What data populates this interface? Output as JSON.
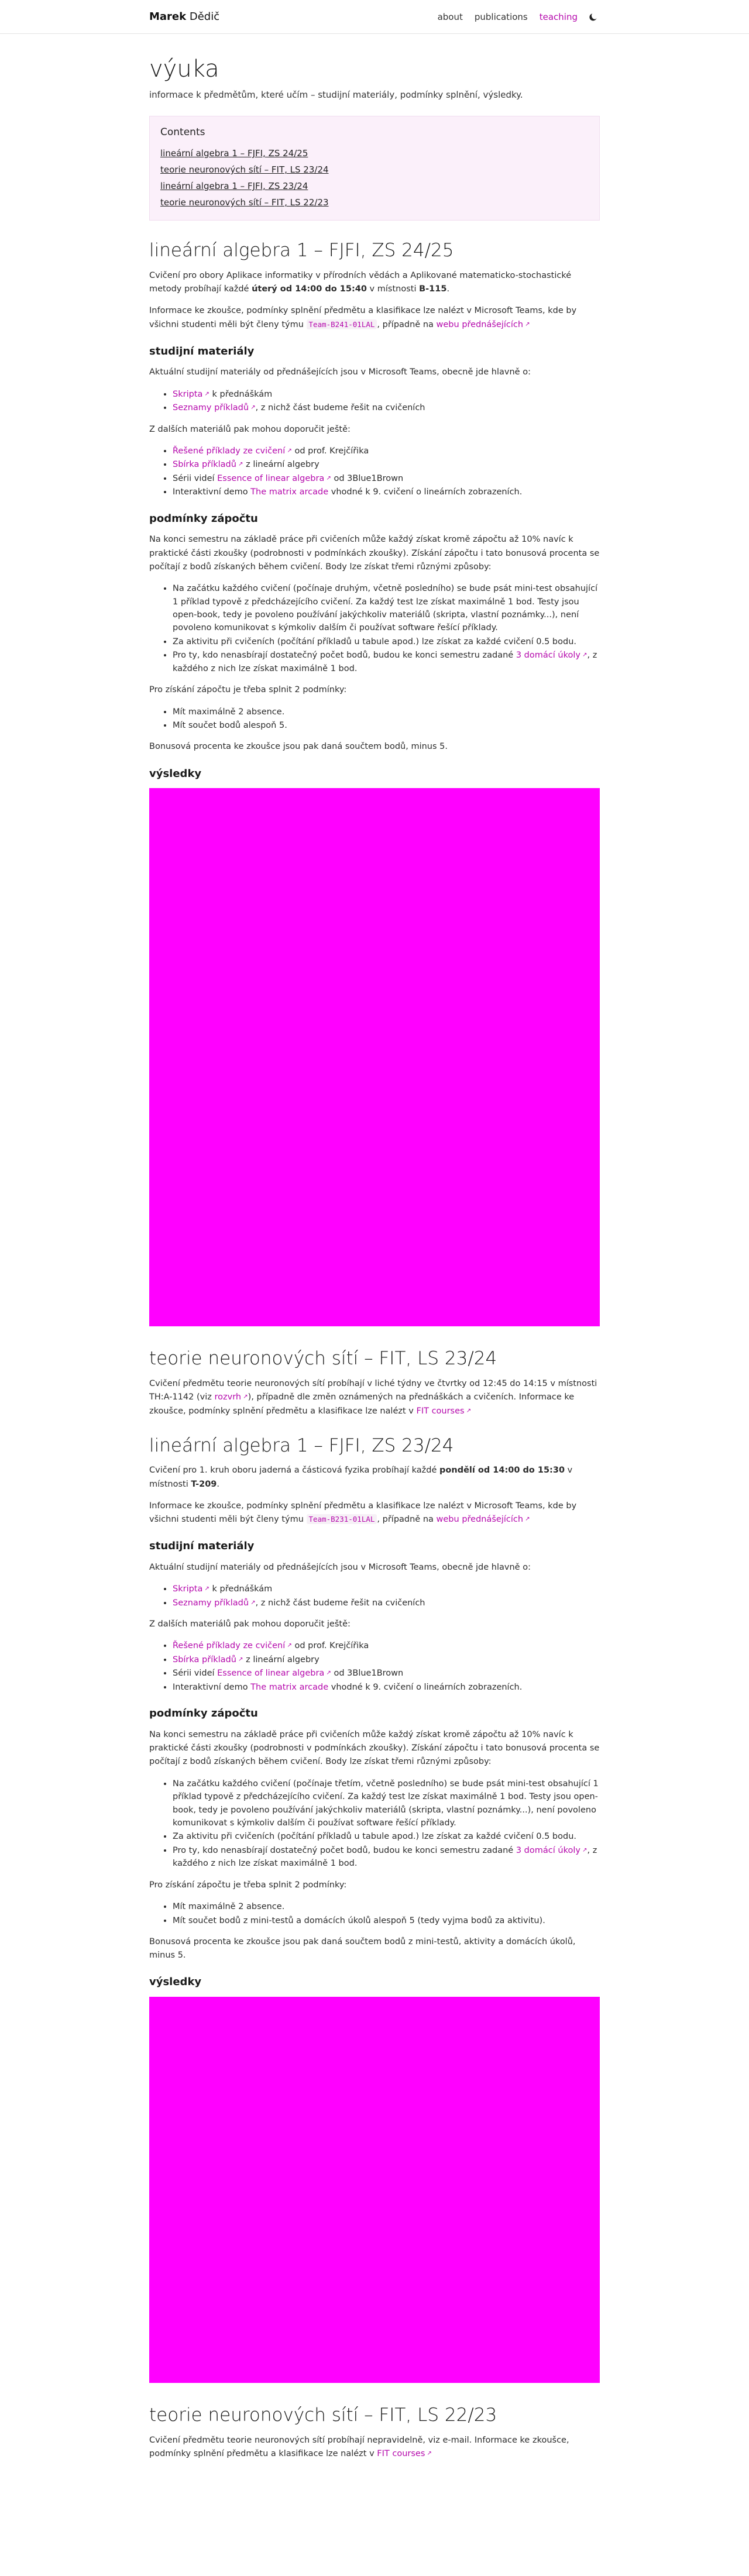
{
  "nav": {
    "brand_first": "Marek",
    "brand_last": "Dědič",
    "links": [
      "about",
      "publications",
      "teaching"
    ],
    "active": "teaching",
    "theme_icon": "moon-icon"
  },
  "page": {
    "title": "výuka",
    "description": "informace k předmětům, které učím – studijní materiály, podmínky splnění, výsledky."
  },
  "toc": {
    "title": "Contents",
    "items": [
      "lineární algebra 1 – FJFI, ZS 24/25",
      "teorie neuronových sítí – FIT, LS 23/24",
      "lineární algebra 1 – FJFI, ZS 23/24",
      "teorie neuronových sítí – FIT, LS 22/23"
    ]
  },
  "la24": {
    "title": "lineární algebra 1 – FJFI, ZS 24/25",
    "intro_a": "Cvičení pro obory Aplikace informatiky v přírodních vědách a Aplikované matematicko-stochastické metody probíhají každé ",
    "intro_time": "úterý od 14:00 do 15:40",
    "intro_b": " v místnosti ",
    "intro_room": "B-115",
    "intro_c": ".",
    "info_a": "Informace ke zkoušce, podmínky splnění předmětu a klasifikace lze nalézt v Microsoft Teams, kde by všichni studenti měli být členy týmu ",
    "team_code": "Team-B241-01LAL",
    "info_b": ", případně na ",
    "info_link": "webu přednášejících",
    "info_c": "",
    "materials_title": "studijní materiály",
    "materials_intro": "Aktuální studijní materiály od přednášejících jsou v Microsoft Teams, obecně jde hlavně o:",
    "materials_items": [
      {
        "link": "Skripta",
        "text": " k přednáškám"
      },
      {
        "link": "Seznamy příkladů",
        "text": ", z nichž část budeme řešit na cvičeních"
      }
    ],
    "extra_intro": "Z dalších materiálů pak mohou doporučit ještě:",
    "extra_items": [
      {
        "pre": "",
        "link": "Řešené příklady ze cvičení",
        "post": " od prof. Krejčířika"
      },
      {
        "pre": "",
        "link": "Sbírka příkladů",
        "post": " z lineární algebry"
      },
      {
        "pre": "Sérii videí ",
        "link": "Essence of linear algebra",
        "post": " od 3Blue1Brown"
      },
      {
        "pre": "Interaktivní demo ",
        "link": "The matrix arcade",
        "post": " vhodné k 9. cvičení o lineárních zobrazeních."
      }
    ],
    "conditions_title": "podmínky zápočtu",
    "conditions_p": "Na konci semestru na základě práce při cvičeních může každý získat kromě zápočtu až 10% navíc k praktické části zkoušky (podrobnosti v podmínkách zkoušky). Získání zápočtu i tato bonusová procenta se počítají z bodů získaných během cvičení. Body lze získat třemi různými způsoby:",
    "conditions_items": [
      {
        "pre": "Na začátku každého cvičení (počínaje druhým, včetně posledního) se bude psát mini-test obsahující 1 příklad typově z předcházejícího cvičení. Za každý test lze získat maximálně 1 bod. Testy jsou open-book, tedy je povoleno používání jakýchkoliv materiálů (skripta, vlastní poznámky...), není povoleno komunikovat s kýmkoliv dalším či používat software řešící příklady.",
        "link": "",
        "post": ""
      },
      {
        "pre": "Za aktivitu při cvičeních (počítání příkladů u tabule apod.) lze získat za každé cvičení 0.5 bodu.",
        "link": "",
        "post": ""
      },
      {
        "pre": "Pro ty, kdo nenasbírají dostatečný počet bodů, budou ke konci semestru zadané ",
        "link": "3 domácí úkoly",
        "post": ", z každého z nich lze získat maximálně 1 bod."
      }
    ],
    "req_intro": "Pro získání zápočtu je třeba splnit 2 podmínky:",
    "req_items": [
      "Mít maximálně 2 absence.",
      "Mít součet bodů alespoň 5."
    ],
    "bonus": "Bonusová procenta ke zkoušce jsou pak daná součtem bodů, minus 5.",
    "results_title": "výsledky"
  },
  "nn24": {
    "title": "teorie neuronových sítí – FIT, LS 23/24",
    "p_a": "Cvičení předmětu teorie neuronových sítí probíhají v liché týdny ve čtvrtky od 12:45 do 14:15 v místnosti TH:A-1142 (viz ",
    "p_link1": "rozvrh",
    "p_b": "), případně dle změn oznámených na přednáškách a cvičeních. Informace ke zkoušce, podmínky splnění předmětu a klasifikace lze nalézt v ",
    "p_link2": "FIT courses",
    "p_c": ""
  },
  "la23": {
    "title": "lineární algebra 1 – FJFI, ZS 23/24",
    "intro_a": "Cvičení pro 1. kruh oboru jaderná a částicová fyzika probíhají každé ",
    "intro_time": "pondělí od 14:00 do 15:30",
    "intro_b": " v místnosti ",
    "intro_room": "T-209",
    "intro_c": ".",
    "info_a": "Informace ke zkoušce, podmínky splnění předmětu a klasifikace lze nalézt v Microsoft Teams, kde by všichni studenti měli být členy týmu ",
    "team_code": "Team-B231-01LAL",
    "info_b": ", případně na ",
    "info_link": "webu přednášejících",
    "info_c": "",
    "materials_title": "studijní materiály",
    "materials_intro": "Aktuální studijní materiály od přednášejících jsou v Microsoft Teams, obecně jde hlavně o:",
    "materials_items": [
      {
        "link": "Skripta",
        "text": " k přednáškám"
      },
      {
        "link": "Seznamy příkladů",
        "text": ", z nichž část budeme řešit na cvičeních"
      }
    ],
    "extra_intro": "Z dalších materiálů pak mohou doporučit ještě:",
    "extra_items": [
      {
        "pre": "",
        "link": "Řešené příklady ze cvičení",
        "post": " od prof. Krejčířika"
      },
      {
        "pre": "",
        "link": "Sbírka příkladů",
        "post": " z lineární algebry"
      },
      {
        "pre": "Sérii videí ",
        "link": "Essence of linear algebra",
        "post": " od 3Blue1Brown"
      },
      {
        "pre": "Interaktivní demo ",
        "link": "The matrix arcade",
        "post": " vhodné k 9. cvičení o lineárních zobrazeních."
      }
    ],
    "conditions_title": "podmínky zápočtu",
    "conditions_p": "Na konci semestru na základě práce při cvičeních může každý získat kromě zápočtu až 10% navíc k praktické části zkoušky (podrobnosti v podmínkách zkoušky). Získání zápočtu i tato bonusová procenta se počítají z bodů získaných během cvičení. Body lze získat třemi různými způsoby:",
    "conditions_items": [
      {
        "pre": "Na začátku každého cvičení (počínaje třetím, včetně posledního) se bude psát mini-test obsahující 1 příklad typově z předcházejícího cvičení. Za každý test lze získat maximálně 1 bod. Testy jsou open-book, tedy je povoleno používání jakýchkoliv materiálů (skripta, vlastní poznámky...), není povoleno komunikovat s kýmkoliv dalším či používat software řešící příklady.",
        "link": "",
        "post": ""
      },
      {
        "pre": "Za aktivitu při cvičeních (počítání příkladů u tabule apod.) lze získat za každé cvičení 0.5 bodu.",
        "link": "",
        "post": ""
      },
      {
        "pre": "Pro ty, kdo nenasbírají dostatečný počet bodů, budou ke konci semestru zadané ",
        "link": "3 domácí úkoly",
        "post": ", z každého z nich lze získat maximálně 1 bod."
      }
    ],
    "req_intro": "Pro získání zápočtu je třeba splnit 2 podmínky:",
    "req_items": [
      "Mít maximálně 2 absence.",
      "Mít součet bodů z mini-testů a domácích úkolů alespoň 5 (tedy vyjma bodů za aktivitu)."
    ],
    "bonus": "Bonusová procenta ke zkoušce jsou pak daná součtem bodů z mini-testů, aktivity a domácích úkolů, minus 5.",
    "results_title": "výsledky"
  },
  "nn23": {
    "title": "teorie neuronových sítí – FIT, LS 22/23",
    "p_a": "Cvičení předmětu teorie neuronových sítí probíhají nepravidelně, viz e-mail. Informace ke zkoušce, podmínky splnění předmětu a klasifikace lze nalézt v ",
    "p_link": "FIT courses",
    "p_b": ""
  },
  "colors": {
    "accent": "#b509ac",
    "results_placeholder": "#ff00ff",
    "toc_bg": "#fbf0fa"
  }
}
